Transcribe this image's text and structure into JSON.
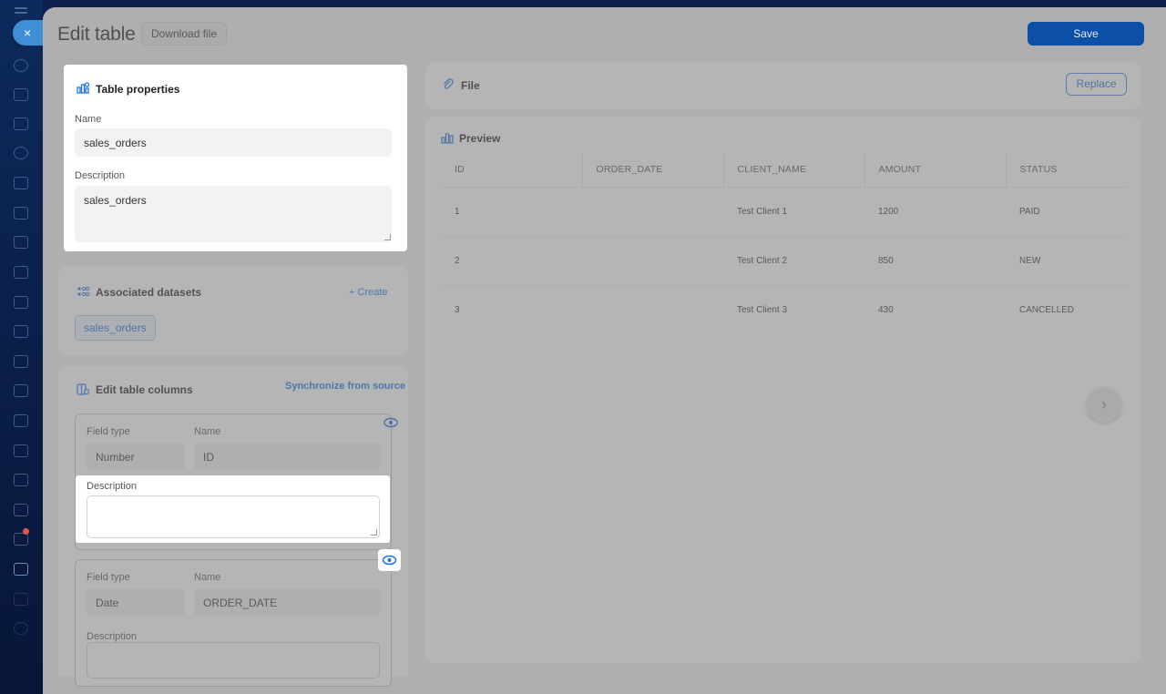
{
  "window": {
    "title": "Edit table",
    "download_label": "Download file",
    "save_label": "Save",
    "close_glyph": "×"
  },
  "table_properties": {
    "title": "Table properties",
    "name_label": "Name",
    "name_value": "sales_orders",
    "description_label": "Description",
    "description_value": "sales_orders"
  },
  "datasets": {
    "title": "Associated datasets",
    "create_label": "+ Create",
    "items": [
      "sales_orders"
    ]
  },
  "columns": {
    "title": "Edit table columns",
    "sync_label": "Synchronize from source",
    "field_type_label": "Field type",
    "name_label": "Name",
    "description_label": "Description",
    "items": [
      {
        "field_type": "Number",
        "name": "ID",
        "description": ""
      },
      {
        "field_type": "Date",
        "name": "ORDER_DATE",
        "description": ""
      }
    ]
  },
  "file": {
    "title": "File",
    "replace_label": "Replace"
  },
  "preview": {
    "title": "Preview",
    "headers": [
      "ID",
      "ORDER_DATE",
      "CLIENT_NAME",
      "AMOUNT",
      "STATUS"
    ],
    "rows": [
      [
        "1",
        "",
        "Test Client 1",
        "1200",
        "PAID"
      ],
      [
        "2",
        "",
        "Test Client 2",
        "850",
        "NEW"
      ],
      [
        "3",
        "",
        "Test Client 3",
        "430",
        "CANCELLED"
      ]
    ],
    "next_glyph": "›"
  },
  "colors": {
    "accent": "#1a73e8",
    "rail": "#0d2a5c"
  }
}
